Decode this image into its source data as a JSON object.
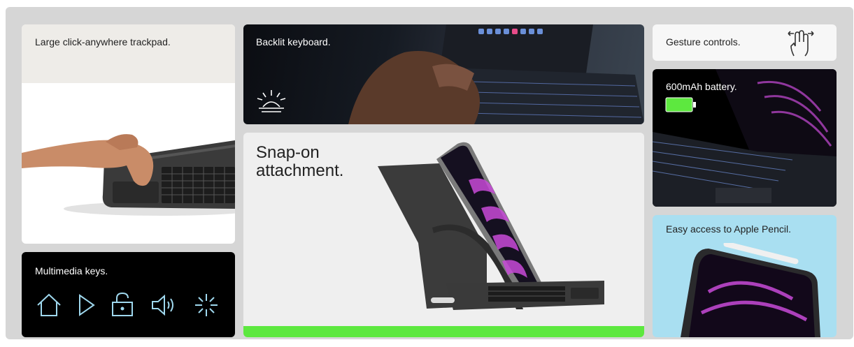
{
  "cards": {
    "trackpad": {
      "label": "Large click-anywhere trackpad."
    },
    "media": {
      "label": "Multimedia keys.",
      "icons": [
        "home-icon",
        "play-icon",
        "lock-icon",
        "volume-icon",
        "brightness-icon"
      ]
    },
    "backlit": {
      "label": "Backlit keyboard.",
      "icon": "light-icon"
    },
    "snap": {
      "label": "Snap-on attachment."
    },
    "gesture": {
      "label": "Gesture controls.",
      "icon": "gesture-hand-icon"
    },
    "battery": {
      "label": "600mAh battery.",
      "icon": "battery-icon"
    },
    "pencil": {
      "label": "Easy access to Apple Pencil."
    }
  },
  "colors": {
    "accent_green": "#5de83f",
    "dark": "#000000",
    "pencil_bg": "#a9dff1",
    "frame_bg": "#d6d6d6"
  }
}
